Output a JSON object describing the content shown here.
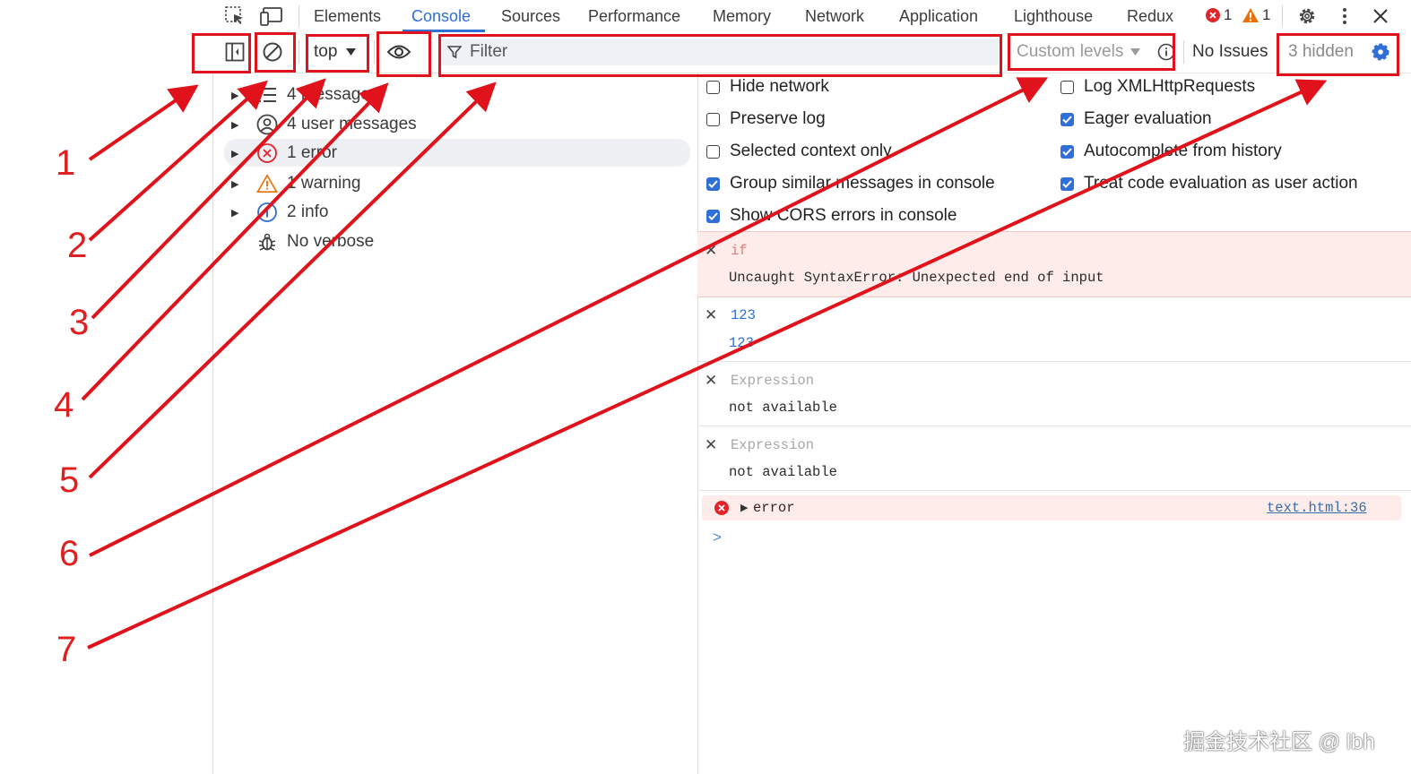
{
  "tabs": {
    "elements": "Elements",
    "console": "Console",
    "sources": "Sources",
    "performance": "Performance",
    "memory": "Memory",
    "network": "Network",
    "application": "Application",
    "lighthouse": "Lighthouse",
    "redux": "Redux"
  },
  "status": {
    "error_count": "1",
    "warning_count": "1"
  },
  "toolbar": {
    "context": "top",
    "filter_placeholder": "Filter",
    "levels": "Custom levels",
    "issues": "No Issues",
    "hidden": "3 hidden"
  },
  "sidebar": {
    "messages": "4 messages",
    "user_messages": "4 user messages",
    "errors": "1 error",
    "warnings": "1 warning",
    "info": "2 info",
    "verbose": "No verbose"
  },
  "settings": {
    "hide_network": "Hide network",
    "preserve_log": "Preserve log",
    "selected_context": "Selected context only",
    "group_similar": "Group similar messages in console",
    "show_cors": "Show CORS errors in console",
    "log_xhr": "Log XMLHttpRequests",
    "eager_eval": "Eager evaluation",
    "autocomplete": "Autocomplete from history",
    "treat_code": "Treat code evaluation as user action"
  },
  "console": {
    "entry1_expr": "if",
    "entry1_result": "Uncaught SyntaxError: Unexpected end of input",
    "entry2_expr": "123",
    "entry2_result": "123",
    "entry3_expr": "Expression",
    "entry3_result": "not available",
    "entry4_expr": "Expression",
    "entry4_result": "not available",
    "error_text": "error",
    "error_source": "text.html:36",
    "prompt": ">"
  },
  "annotations": [
    "1",
    "2",
    "3",
    "4",
    "5",
    "6",
    "7"
  ],
  "watermark": "掘金技术社区 @ lbh",
  "colors": {
    "accent": "#2f6fd6",
    "error": "#e0242a",
    "warning": "#e8710a",
    "annotation": "#e0121b"
  }
}
